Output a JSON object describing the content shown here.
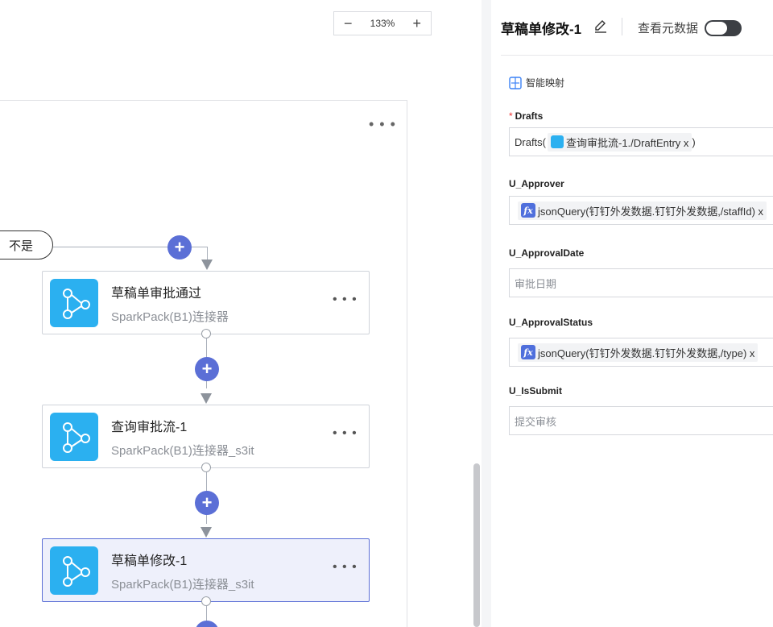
{
  "zoom": {
    "value": "133%",
    "minus": "−",
    "plus": "+"
  },
  "canvas": {
    "menu_dots": "• • •",
    "condition_label": "不是",
    "plus_symbol": "+",
    "nodes": [
      {
        "title": "草稿单审批通过",
        "subtitle": "SparkPack(B1)连接器",
        "more": "• • •"
      },
      {
        "title": "查询审批流-1",
        "subtitle": "SparkPack(B1)连接器_s3it",
        "more": "• • •"
      },
      {
        "title": "草稿单修改-1",
        "subtitle": "SparkPack(B1)连接器_s3it",
        "more": "• • •"
      }
    ]
  },
  "panel": {
    "title": "草稿单修改-1",
    "metadata_label": "查看元数据",
    "smart_mapping": "智能映射",
    "fields": [
      {
        "label": "Drafts",
        "required": "*",
        "prefix": "Drafts(",
        "tag": "查询审批流-1./DraftEntry x",
        "suffix": " )"
      },
      {
        "label": "U_Approver",
        "fx": "fx",
        "tag": "jsonQuery(钉钉外发数据.钉钉外发数据,/staffId) x"
      },
      {
        "label": "U_ApprovalDate",
        "placeholder": "审批日期"
      },
      {
        "label": "U_ApprovalStatus",
        "fx": "fx",
        "tag": "jsonQuery(钉钉外发数据.钉钉外发数据,/type) x"
      },
      {
        "label": "U_IsSubmit",
        "placeholder": "提交审核"
      }
    ]
  },
  "colors": {
    "accent": "#5b6fd6",
    "node_icon": "#2bb0f0",
    "selected_bg": "#eef0fb"
  }
}
